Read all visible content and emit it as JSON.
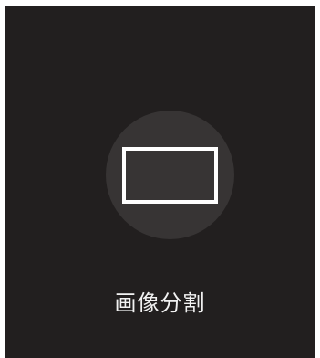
{
  "tile": {
    "label": "画像分割",
    "background": "#221f1f"
  },
  "icon": {
    "name": "single-frame-icon",
    "circle_color": "#373434",
    "frame_color": "#ffffff"
  }
}
